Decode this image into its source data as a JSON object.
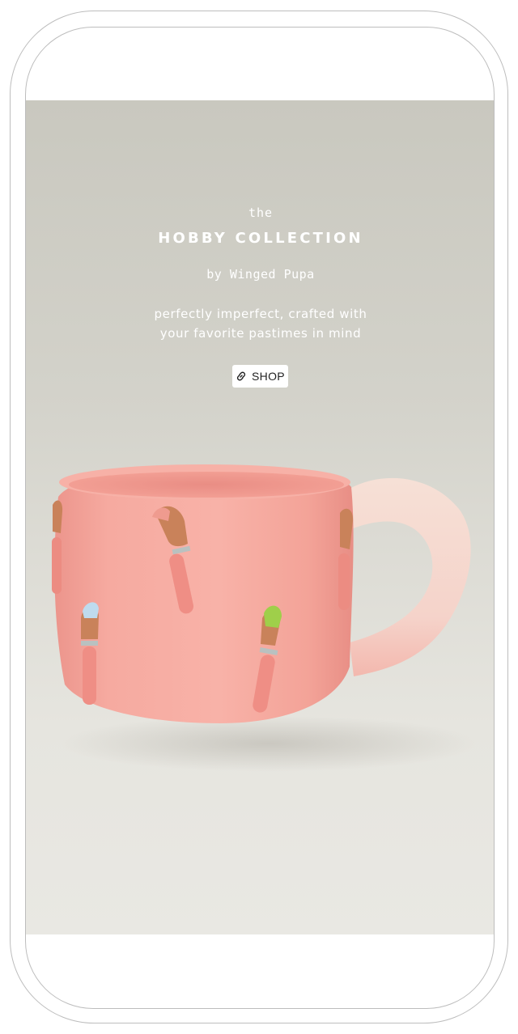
{
  "hero": {
    "eyebrow": "the",
    "title": "HOBBY COLLECTION",
    "byline": "by Winged Pupa",
    "tagline_line1": "perfectly imperfect, crafted with",
    "tagline_line2": "your favorite pastimes in mind",
    "shop_button": {
      "icon": "link-icon",
      "label": "SHOP"
    },
    "image": {
      "subject": "pink ceramic mug with paintbrush details",
      "colors": {
        "background": "#d3d2ca",
        "mug_body": "#f4a9a0",
        "handle": "#f3ddd3"
      }
    }
  }
}
